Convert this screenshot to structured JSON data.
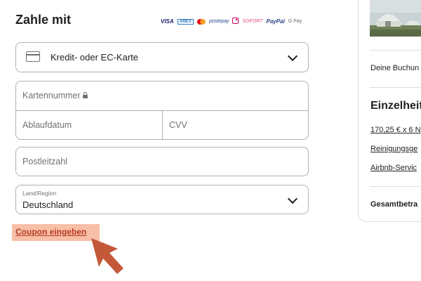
{
  "payment": {
    "heading": "Zahle mit",
    "logos": [
      {
        "name": "visa",
        "text": "VISA"
      },
      {
        "name": "amex",
        "text": "AMEX"
      },
      {
        "name": "mastercard",
        "text": ""
      },
      {
        "name": "postepay",
        "text": "postepay"
      },
      {
        "name": "ideal",
        "text": ""
      },
      {
        "name": "sofort",
        "text": "SOFORT"
      },
      {
        "name": "paypal",
        "text": "PayPal"
      },
      {
        "name": "google-pay",
        "text": "G Pay"
      }
    ],
    "method_select": {
      "value": "Kredit- oder EC-Karte",
      "icon": "credit-card-icon"
    },
    "card_number": {
      "placeholder": "Kartennummer",
      "icon": "lock-icon"
    },
    "expiry": {
      "placeholder": "Ablaufdatum"
    },
    "cvv": {
      "placeholder": "CVV"
    },
    "postcode": {
      "placeholder": "Postleitzahl"
    },
    "country": {
      "label": "Land/Region",
      "value": "Deutschland"
    },
    "coupon_link": "Coupon eingeben"
  },
  "summary": {
    "booking_text": "Deine Buchun",
    "details_heading": "Einzelheit",
    "price_rows": [
      {
        "label": "170,25 € x 6 N"
      },
      {
        "label": "Reinigungsge"
      },
      {
        "label": "Airbnb-Servic"
      }
    ],
    "total_label": "Gesamtbetra"
  },
  "colors": {
    "accent": "#b73a1e",
    "highlight": "#f7bfa8",
    "cursor": "#c4593a",
    "border": "#b0b0b0"
  }
}
